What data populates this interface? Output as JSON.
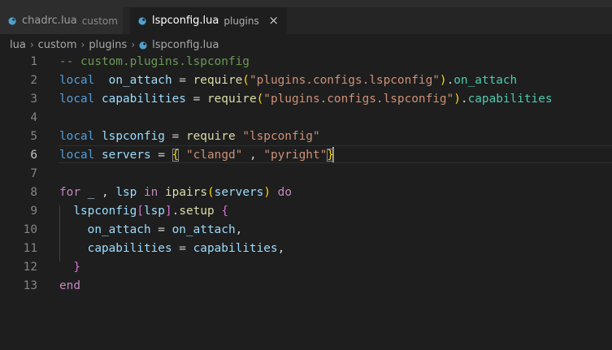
{
  "tabs": [
    {
      "name": "chadrc.lua",
      "description": "custom",
      "active": false
    },
    {
      "name": "lspconfig.lua",
      "description": "plugins",
      "active": true,
      "close": "×"
    }
  ],
  "breadcrumb": {
    "items": [
      "lua",
      "custom",
      "plugins",
      "lspconfig.lua"
    ]
  },
  "editor": {
    "active_line": 6,
    "lines": [
      {
        "n": "1",
        "tokens": [
          [
            "cmt",
            "-- custom.plugins.lspconfig"
          ]
        ]
      },
      {
        "n": "2",
        "tokens": [
          [
            "kw",
            "local"
          ],
          [
            "",
            "  "
          ],
          [
            "var",
            "on_attach"
          ],
          [
            "",
            " = "
          ],
          [
            "fn",
            "require"
          ],
          [
            "br1",
            "("
          ],
          [
            "str",
            "\"plugins.configs.lspconfig\""
          ],
          [
            "br1",
            ")"
          ],
          [
            "",
            "."
          ],
          [
            "prop",
            "on_attach"
          ]
        ]
      },
      {
        "n": "3",
        "tokens": [
          [
            "kw",
            "local"
          ],
          [
            "",
            " "
          ],
          [
            "var",
            "capabilities"
          ],
          [
            "",
            " = "
          ],
          [
            "fn",
            "require"
          ],
          [
            "br1",
            "("
          ],
          [
            "str",
            "\"plugins.configs.lspconfig\""
          ],
          [
            "br1",
            ")"
          ],
          [
            "",
            "."
          ],
          [
            "prop",
            "capabilities"
          ]
        ]
      },
      {
        "n": "4",
        "tokens": []
      },
      {
        "n": "5",
        "tokens": [
          [
            "kw",
            "local"
          ],
          [
            "",
            " "
          ],
          [
            "var",
            "lspconfig"
          ],
          [
            "",
            " = "
          ],
          [
            "fn",
            "require"
          ],
          [
            "",
            " "
          ],
          [
            "str",
            "\"lspconfig\""
          ]
        ]
      },
      {
        "n": "6",
        "tokens": [
          [
            "kw",
            "local"
          ],
          [
            "",
            " "
          ],
          [
            "var",
            "servers"
          ],
          [
            "",
            " = "
          ],
          [
            "br1 bm",
            "{"
          ],
          [
            "",
            " "
          ],
          [
            "str",
            "\"clangd\""
          ],
          [
            "",
            " , "
          ],
          [
            "str",
            "\"pyright\""
          ],
          [
            "br1 bm",
            "}"
          ]
        ]
      },
      {
        "n": "7",
        "tokens": []
      },
      {
        "n": "8",
        "tokens": [
          [
            "ctl",
            "for"
          ],
          [
            "",
            " "
          ],
          [
            "var",
            "_"
          ],
          [
            "",
            " , "
          ],
          [
            "var",
            "lsp"
          ],
          [
            "",
            " "
          ],
          [
            "ctl",
            "in"
          ],
          [
            "",
            " "
          ],
          [
            "fn",
            "ipairs"
          ],
          [
            "br1",
            "("
          ],
          [
            "var",
            "servers"
          ],
          [
            "br1",
            ")"
          ],
          [
            "",
            " "
          ],
          [
            "ctl",
            "do"
          ]
        ]
      },
      {
        "n": "9",
        "tokens": [
          [
            "",
            "  "
          ],
          [
            "var",
            "lspconfig"
          ],
          [
            "br2",
            "["
          ],
          [
            "var",
            "lsp"
          ],
          [
            "br2",
            "]"
          ],
          [
            "",
            "."
          ],
          [
            "fn",
            "setup"
          ],
          [
            "",
            " "
          ],
          [
            "br2",
            "{"
          ]
        ]
      },
      {
        "n": "10",
        "tokens": [
          [
            "",
            "    "
          ],
          [
            "var",
            "on_attach"
          ],
          [
            "",
            " = "
          ],
          [
            "var",
            "on_attach"
          ],
          [
            "",
            ","
          ]
        ]
      },
      {
        "n": "11",
        "tokens": [
          [
            "",
            "    "
          ],
          [
            "var",
            "capabilities"
          ],
          [
            "",
            " = "
          ],
          [
            "var",
            "capabilities"
          ],
          [
            "",
            ","
          ]
        ]
      },
      {
        "n": "12",
        "tokens": [
          [
            "",
            "  "
          ],
          [
            "br2",
            "}"
          ]
        ]
      },
      {
        "n": "13",
        "tokens": [
          [
            "ctl",
            "end"
          ]
        ]
      }
    ]
  }
}
